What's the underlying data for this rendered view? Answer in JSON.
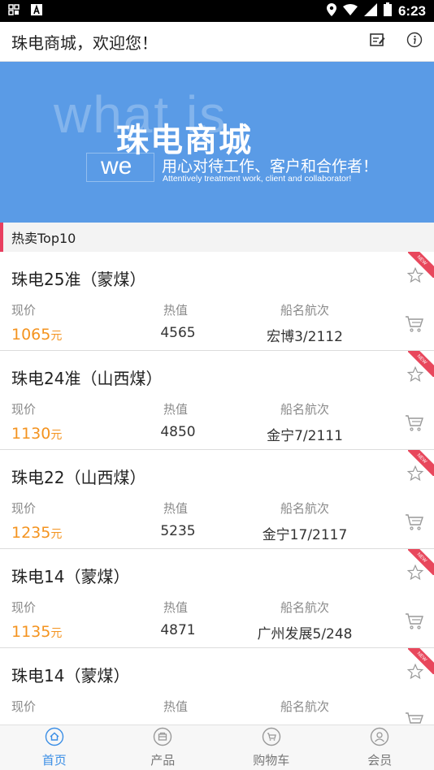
{
  "status_bar": {
    "time": "6:23"
  },
  "header": {
    "title": "珠电商城，欢迎您！"
  },
  "banner": {
    "ghost_text": "what is",
    "title": "珠电商城",
    "we": "we",
    "slogan": "用心对待工作、客户和合作者！",
    "slogan_en": "Attentively treatment work, client and collaborator!"
  },
  "section": {
    "title": "热卖Top10"
  },
  "labels": {
    "price": "现价",
    "heat": "热值",
    "ship": "船名航次",
    "unit": "元",
    "new_badge": "NEW"
  },
  "products": [
    {
      "name": "珠电25准（蒙煤）",
      "price": "1065",
      "heat": "4565",
      "ship": "宏博3/2112"
    },
    {
      "name": "珠电24准（山西煤）",
      "price": "1130",
      "heat": "4850",
      "ship": "金宁7/2111"
    },
    {
      "name": "珠电22（山西煤）",
      "price": "1235",
      "heat": "5235",
      "ship": "金宁17/2117"
    },
    {
      "name": "珠电14（蒙煤）",
      "price": "1135",
      "heat": "4871",
      "ship": "广州发展5/248"
    },
    {
      "name": "珠电14（蒙煤）",
      "price": "",
      "heat": "",
      "ship": ""
    }
  ],
  "nav": [
    {
      "label": "首页",
      "icon": "home-icon",
      "active": true
    },
    {
      "label": "产品",
      "icon": "product-icon",
      "active": false
    },
    {
      "label": "购物车",
      "icon": "cart-icon",
      "active": false
    },
    {
      "label": "会员",
      "icon": "member-icon",
      "active": false
    }
  ],
  "colors": {
    "accent": "#3a8ee6",
    "price": "#f4931f",
    "banner": "#5a9be6",
    "section_bar": "#e83e5f",
    "badge": "#e8475c"
  }
}
